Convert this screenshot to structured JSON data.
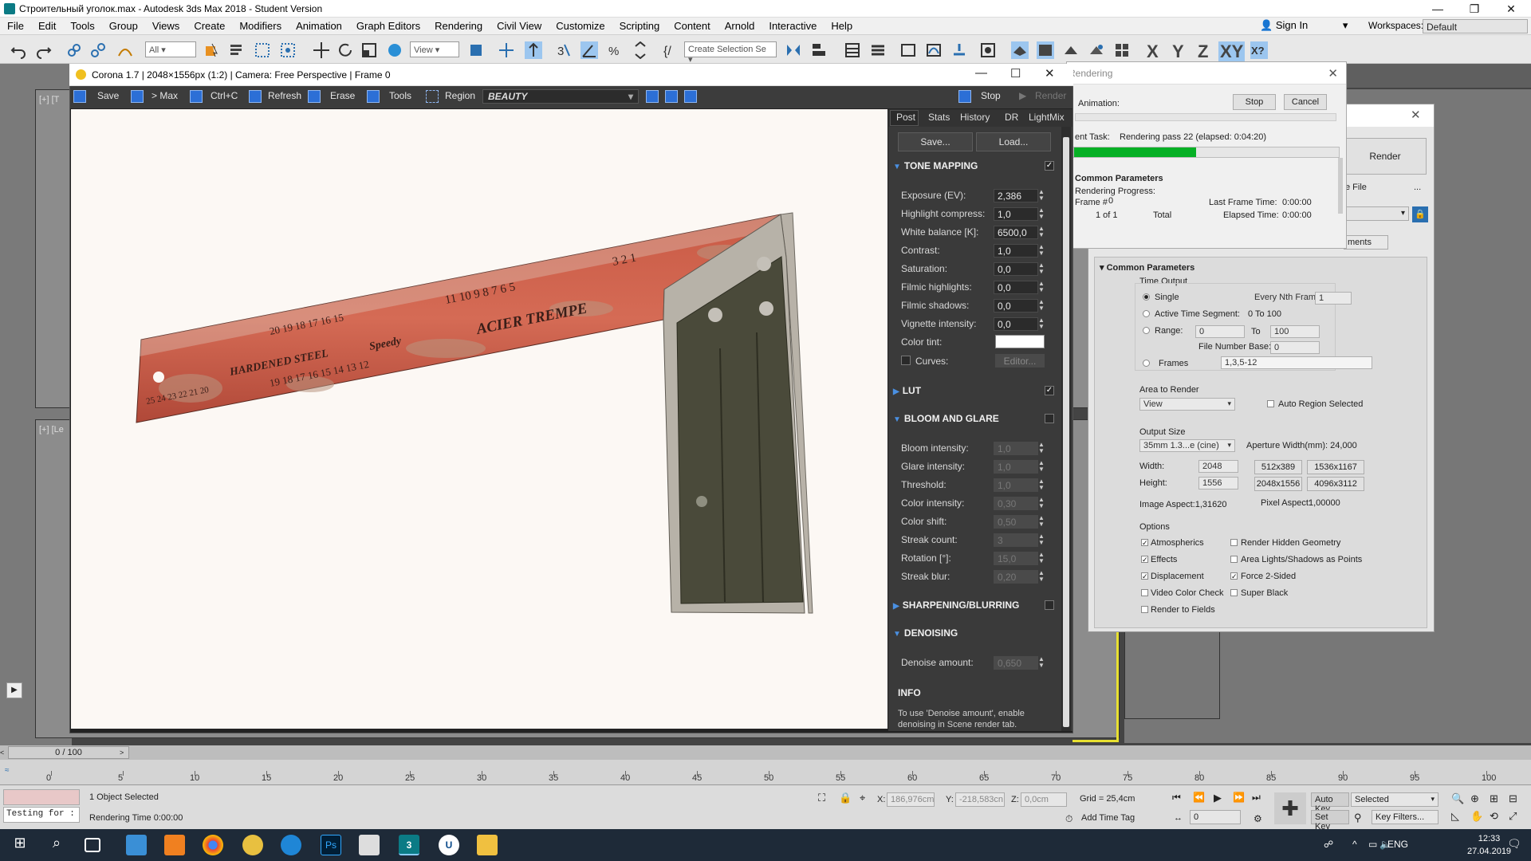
{
  "window": {
    "title": "Строительный уголок.max - Autodesk 3ds Max 2018 - Student Version",
    "controls": [
      "—",
      "❐",
      "✕"
    ]
  },
  "menu": {
    "items": [
      "File",
      "Edit",
      "Tools",
      "Group",
      "Views",
      "Create",
      "Modifiers",
      "Animation",
      "Graph Editors",
      "Rendering",
      "Civil View",
      "Customize",
      "Scripting",
      "Content",
      "Arnold",
      "Interactive",
      "Help"
    ],
    "sign_in": "Sign In",
    "workspaces_label": "Workspaces:",
    "workspaces_value": "Default"
  },
  "toolbar": {
    "filter_value": "All",
    "view_value": "View",
    "selection_set_placeholder": "Create Selection Se",
    "axes": [
      "X",
      "Y",
      "Z",
      "XY"
    ]
  },
  "viewport_labels": [
    "[+] [T",
    "[+] [Le"
  ],
  "vfb": {
    "title": "Corona 1.7 | 2048×1556px (1:2) | Camera: Free Perspective | Frame 0",
    "buttons": {
      "save": "Save",
      "to_max": "> Max",
      "copy": "Ctrl+C",
      "refresh": "Refresh",
      "erase": "Erase",
      "tools": "Tools",
      "region": "Region",
      "stop": "Stop",
      "render": "Render"
    },
    "channel": "BEAUTY",
    "tabs": [
      "Post",
      "Stats",
      "History",
      "DR",
      "LightMix"
    ],
    "panel_buttons": {
      "save": "Save...",
      "load": "Load..."
    },
    "tone_mapping": {
      "title": "TONE MAPPING",
      "enabled": "✓",
      "params": [
        {
          "label": "Exposure (EV):",
          "value": "2,386"
        },
        {
          "label": "Highlight compress:",
          "value": "1,0"
        },
        {
          "label": "White balance [K]:",
          "value": "6500,0"
        },
        {
          "label": "Contrast:",
          "value": "1,0"
        },
        {
          "label": "Saturation:",
          "value": "0,0"
        },
        {
          "label": "Filmic highlights:",
          "value": "0,0"
        },
        {
          "label": "Filmic shadows:",
          "value": "0,0"
        },
        {
          "label": "Vignette intensity:",
          "value": "0,0"
        }
      ],
      "color_tint_label": "Color tint:",
      "curves_label": "Curves:",
      "curves_editor": "Editor..."
    },
    "lut": {
      "title": "LUT",
      "enabled": "✓"
    },
    "bloom": {
      "title": "BLOOM AND GLARE",
      "params": [
        {
          "label": "Bloom intensity:",
          "value": "1,0"
        },
        {
          "label": "Glare intensity:",
          "value": "1,0"
        },
        {
          "label": "Threshold:",
          "value": "1,0"
        },
        {
          "label": "Color intensity:",
          "value": "0,30"
        },
        {
          "label": "Color shift:",
          "value": "0,50"
        },
        {
          "label": "Streak count:",
          "value": "3"
        },
        {
          "label": "Rotation [°]:",
          "value": "15,0"
        },
        {
          "label": "Streak blur:",
          "value": "0,20"
        }
      ]
    },
    "sharpening": {
      "title": "SHARPENING/BLURRING"
    },
    "denoising": {
      "title": "DENOISING",
      "param_label": "Denoise amount:",
      "param_value": "0,650"
    },
    "info": {
      "title": "INFO",
      "text": "To use 'Denoise amount', enable denoising in Scene render tab."
    }
  },
  "ruler_text": {
    "top_row": "3 2 1",
    "mid_row": "11 10 9 8 7 6 5",
    "left_row": "20 19 18 17 16 15",
    "bottom_row": "19 18 17 16 15 14 13 12",
    "left_small": "25 24 23 22 21 20",
    "brand1": "ACIER TREMPE",
    "brand2": "HARDENED STEEL",
    "brand3": "Speedy"
  },
  "rendering_dialog": {
    "title": "Rendering",
    "animation_label": "Animation:",
    "stop": "Stop",
    "cancel": "Cancel",
    "task_label": "ent Task:",
    "task_value": "Rendering pass 22 (elapsed: 0:04:20)",
    "progress": 0.46,
    "common_params": "Common Parameters",
    "rendering_progress": "Rendering Progress:",
    "frame_label": "Frame #",
    "frame_value": "0",
    "of_label": "1 of 1",
    "total_label": "Total",
    "last_frame_label": "Last Frame Time:",
    "last_frame_value": "0:00:00",
    "elapsed_label": "Elapsed Time:",
    "elapsed_value": "0:00:00"
  },
  "render_setup": {
    "render_button": "Render",
    "file_label": "e File",
    "ellipsis": "...",
    "tab_label": "ments",
    "section": "Common Parameters",
    "time_output": "Time Output",
    "single": "Single",
    "every_nth": "Every Nth Frame:",
    "every_nth_value": "1",
    "active_segment": "Active Time Segment:",
    "active_segment_value": "0 To 100",
    "range": "Range:",
    "range_from": "0",
    "range_to_label": "To",
    "range_to": "100",
    "file_number_base": "File Number Base:",
    "file_number_base_value": "0",
    "frames": "Frames",
    "frames_value": "1,3,5-12",
    "area_to_render": "Area to Render",
    "area_value": "View",
    "auto_region": "Auto Region Selected",
    "output_size": "Output Size",
    "film_value": "35mm 1.3...e (cine)",
    "aperture": "Aperture Width(mm): 24,000",
    "width_label": "Width:",
    "width_value": "2048",
    "height_label": "Height:",
    "height_value": "1556",
    "presets": [
      "512x389",
      "1536x1167",
      "2048x1556",
      "4096x3112"
    ],
    "image_aspect": "Image Aspect:1,31620",
    "pixel_aspect_label": "Pixel Aspect:",
    "pixel_aspect_value": "1,00000",
    "options": "Options",
    "opts": [
      {
        "label": "Atmospherics",
        "checked": "✓"
      },
      {
        "label": "Render Hidden Geometry",
        "checked": ""
      },
      {
        "label": "Effects",
        "checked": "✓"
      },
      {
        "label": "Area Lights/Shadows as Points",
        "checked": ""
      },
      {
        "label": "Displacement",
        "checked": "✓"
      },
      {
        "label": "Force 2-Sided",
        "checked": "✓"
      },
      {
        "label": "Video Color Check",
        "checked": ""
      },
      {
        "label": "Super Black",
        "checked": ""
      },
      {
        "label": "Render to Fields",
        "checked": ""
      }
    ]
  },
  "timeline": {
    "frame_counter": "0 / 100",
    "ticks": [
      "0",
      "5",
      "10",
      "15",
      "20",
      "25",
      "30",
      "35",
      "40",
      "45",
      "50",
      "55",
      "60",
      "65",
      "70",
      "75",
      "80",
      "85",
      "90",
      "95",
      "100"
    ]
  },
  "status": {
    "maxscript": "Testing for :",
    "selected": "1 Object Selected",
    "render_time": "Rendering Time 0:00:00",
    "x_label": "X:",
    "x_value": "186,976cm",
    "y_label": "Y:",
    "y_value": "-218,583cn",
    "z_label": "Z:",
    "z_value": "0,0cm",
    "grid": "Grid = 25,4cm",
    "add_time_tag": "Add Time Tag",
    "auto_key": "Auto Key",
    "set_key": "Set Key",
    "selected_dropdown": "Selected",
    "key_filters": "Key Filters...",
    "frame_field": "0"
  },
  "taskbar": {
    "lang": "ENG",
    "time": "12:33",
    "date": "27.04.2019"
  }
}
